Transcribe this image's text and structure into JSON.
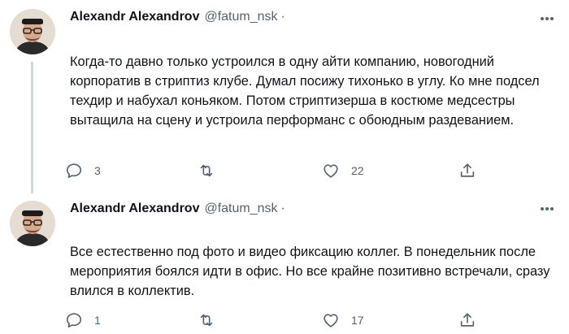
{
  "colors": {
    "text": "#0f1419",
    "secondary": "#536471",
    "thread_line": "#cfd9de"
  },
  "tweets": [
    {
      "author_name": "Alexandr Alexandrov",
      "author_handle": "@fatum_nsk",
      "separator": "·",
      "text": "Когда-то давно только устроился в одну айти компанию, новогодний корпоратив в стриптиз клубе. Думал посижу тихонько в углу. Ко мне подсел техдир и набухал коньяком. Потом стриптизерша в костюме медсестры вытащила на сцену и устроила перформанс с обоюдным раздеванием.",
      "reply_count": "3",
      "retweet_count": "",
      "like_count": "22"
    },
    {
      "author_name": "Alexandr Alexandrov",
      "author_handle": "@fatum_nsk",
      "separator": "·",
      "text": "Все естественно под фото и видео фиксацию коллег. В понедельник после мероприятия боялся идти в офис. Но все крайне позитивно встречали, сразу влился в коллектив.",
      "reply_count": "1",
      "retweet_count": "",
      "like_count": "17"
    }
  ]
}
